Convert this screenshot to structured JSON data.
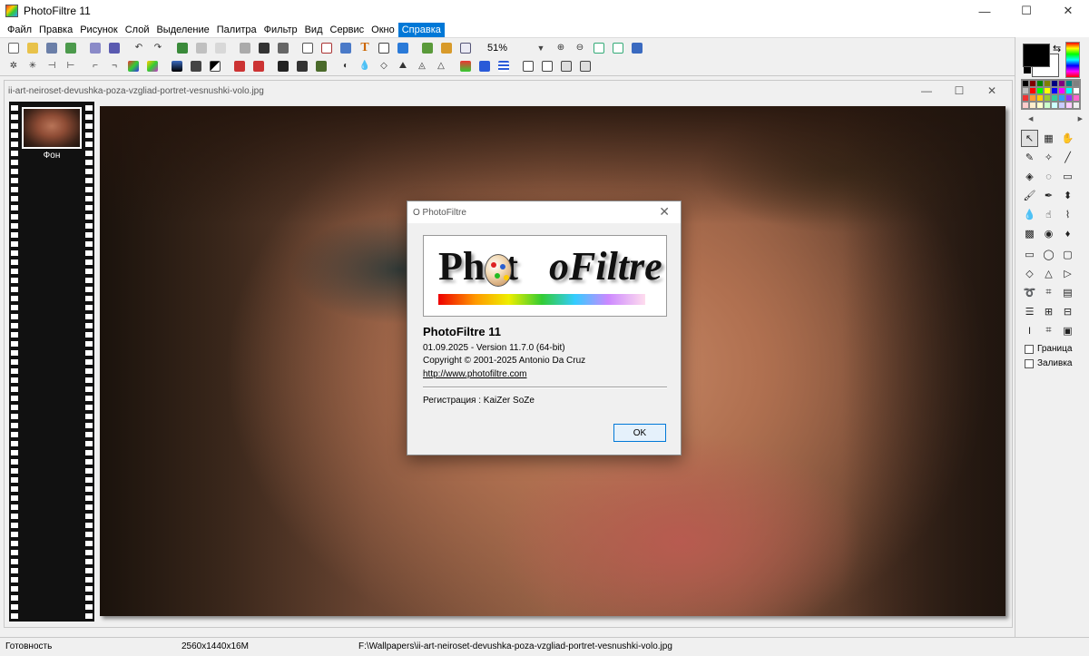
{
  "app": {
    "title": "PhotoFiltre 11"
  },
  "window_controls": {
    "minimize": "—",
    "maximize": "☐",
    "close": "✕"
  },
  "menu": [
    {
      "label": "Файл"
    },
    {
      "label": "Правка"
    },
    {
      "label": "Рисунок"
    },
    {
      "label": "Слой"
    },
    {
      "label": "Выделение"
    },
    {
      "label": "Палитра"
    },
    {
      "label": "Фильтр"
    },
    {
      "label": "Вид"
    },
    {
      "label": "Сервис"
    },
    {
      "label": "Окно"
    },
    {
      "label": "Справка",
      "active": true
    }
  ],
  "toolbar": {
    "zoom_value": "51%",
    "text_tool_label": "T"
  },
  "document": {
    "title": "ii-art-neiroset-devushka-poza-vzgliad-portret-vesnushki-volo.jpg",
    "layer_name": "Фон"
  },
  "about_dialog": {
    "title": "О PhotoFiltre",
    "logo_text_main": "Phot",
    "logo_text_second": "Filtre",
    "logo_text_o": "o",
    "product": "PhotoFiltre 11",
    "version": "01.09.2025 - Version 11.7.0 (64-bit)",
    "copyright": "Copyright © 2001-2025 Antonio Da Cruz",
    "url": "http://www.photofiltre.com",
    "registration": "Регистрация : KaiZer SoZe",
    "ok_label": "OK"
  },
  "right_panel": {
    "foreground_color": "#000000",
    "background_color": "#ffffff",
    "border_label": "Граница",
    "fill_label": "Заливка"
  },
  "statusbar": {
    "status": "Готовность",
    "image_info": "2560x1440x16M",
    "path": "F:\\Wallpapers\\ii-art-neiroset-devushka-poza-vzgliad-portret-vesnushki-volo.jpg"
  }
}
